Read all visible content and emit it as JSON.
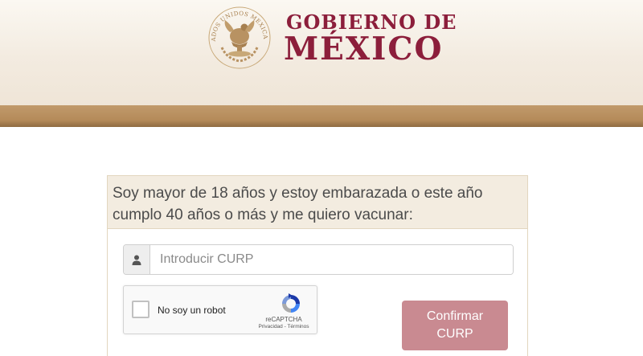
{
  "header": {
    "seal_text": "ESTADOS UNIDOS MEXICANOS",
    "brand_line1": "GOBIERNO DE",
    "brand_line2": "MÉXICO",
    "colors": {
      "brand": "#8c1e3b",
      "band": "#b48a59"
    },
    "seal_icon": "mexico-coat-of-arms-icon"
  },
  "form": {
    "heading": "Soy mayor de 18 años y estoy embarazada o este año cumplo 40 años o más y me quiero vacunar:",
    "curp_placeholder": "Introducir CURP",
    "curp_value": "",
    "curp_icon": "user-icon",
    "recaptcha": {
      "label": "No soy un robot",
      "brand": "reCAPTCHA",
      "terms": "Privacidad - Términos",
      "checked": false,
      "logo_icon": "recaptcha-logo-icon"
    },
    "confirm_button": "Confirmar CURP",
    "colors": {
      "button": "#c98a91",
      "heading_bg": "#f3ece0"
    }
  }
}
